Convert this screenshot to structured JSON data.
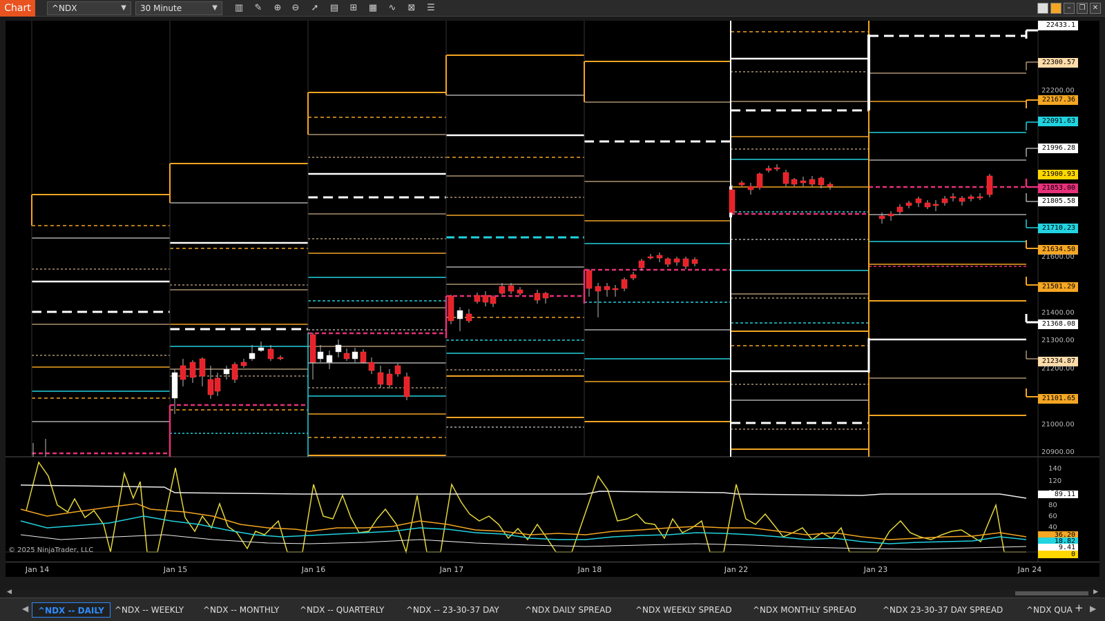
{
  "window": {
    "badge": "Chart",
    "instrument": "^NDX",
    "interval": "30 Minute"
  },
  "toolbar_icons": [
    "bar-chart-icon",
    "pencil-icon",
    "zoom-in-icon",
    "zoom-out-icon",
    "cursor-icon",
    "properties-icon",
    "template-icon",
    "data-box-icon",
    "indicator-icon",
    "strategy-icon",
    "list-icon"
  ],
  "price_axis": {
    "ticks": [
      "22200.00",
      "21600.00",
      "21400.00",
      "21300.00",
      "21200.00",
      "21000.00",
      "20900.00"
    ],
    "tags": [
      {
        "label": "22433.1",
        "value": 22433.1,
        "color": "#ffffff"
      },
      {
        "label": "22300.57",
        "value": 22300.57,
        "color": "#ffdcaa"
      },
      {
        "label": "22167.36",
        "value": 22167.36,
        "color": "#f5a623"
      },
      {
        "label": "22091.63",
        "value": 22091.63,
        "color": "#22d3e0"
      },
      {
        "label": "21996.28",
        "value": 21996.28,
        "color": "#ffffff"
      },
      {
        "label": "21900.93",
        "value": 21900.93,
        "color": "#ffd700"
      },
      {
        "label": "21853.00",
        "value": 21853.0,
        "color": "#e8307a"
      },
      {
        "label": "21805.58",
        "value": 21805.58,
        "color": "#ffffff"
      },
      {
        "label": "21710.23",
        "value": 21710.23,
        "color": "#22d3e0"
      },
      {
        "label": "21634.50",
        "value": 21634.5,
        "color": "#f5a623"
      },
      {
        "label": "21501.29",
        "value": 21501.29,
        "color": "#f5a623"
      },
      {
        "label": "21368.08",
        "value": 21368.08,
        "color": "#ffffff"
      },
      {
        "label": "21234.87",
        "value": 21234.87,
        "color": "#ffdcaa"
      },
      {
        "label": "21101.65",
        "value": 21101.65,
        "color": "#f5a623"
      }
    ]
  },
  "indicator_axis": {
    "ticks": [
      "140",
      "120",
      "100",
      "80",
      "60",
      "40",
      "0"
    ],
    "tags": [
      {
        "label": "89.11",
        "color": "#ffffff"
      },
      {
        "label": "36.20",
        "color": "#f5a623"
      },
      {
        "label": "18.82",
        "color": "#22d3e0"
      },
      {
        "label": "9.41",
        "color": "#ffffff"
      },
      {
        "label": "0",
        "color": "#ffd700"
      }
    ]
  },
  "copyright": "© 2025 NinjaTrader, LLC",
  "x_axis": {
    "labels": [
      "Jan 14",
      "Jan 15",
      "Jan 16",
      "Jan 17",
      "Jan 18",
      "Jan 22",
      "Jan 23",
      "Jan 24"
    ]
  },
  "tabs": {
    "items": [
      {
        "label": "^NDX -- DAILY",
        "active": true
      },
      {
        "label": "^NDX -- WEEKLY",
        "active": false
      },
      {
        "label": "^NDX -- MONTHLY",
        "active": false
      },
      {
        "label": "^NDX -- QUARTERLY",
        "active": false
      },
      {
        "label": "^NDX -- 23-30-37 DAY",
        "active": false
      },
      {
        "label": "^NDX DAILY SPREAD",
        "active": false
      },
      {
        "label": "^NDX WEEKLY SPREAD",
        "active": false
      },
      {
        "label": "^NDX MONTHLY SPREAD",
        "active": false
      },
      {
        "label": "^NDX 23-30-37 DAY SPREAD",
        "active": false
      },
      {
        "label": "^NDX QUA",
        "active": false
      }
    ],
    "add_label": "+"
  },
  "colors": {
    "orange": "#f5a623",
    "cyan": "#22d3e0",
    "magenta": "#e8307a",
    "white": "#ffffff",
    "yellow": "#e3d73a",
    "tan": "#ffdcaa",
    "candle_up": "#ffffff",
    "candle_down": "#e8222a"
  }
}
